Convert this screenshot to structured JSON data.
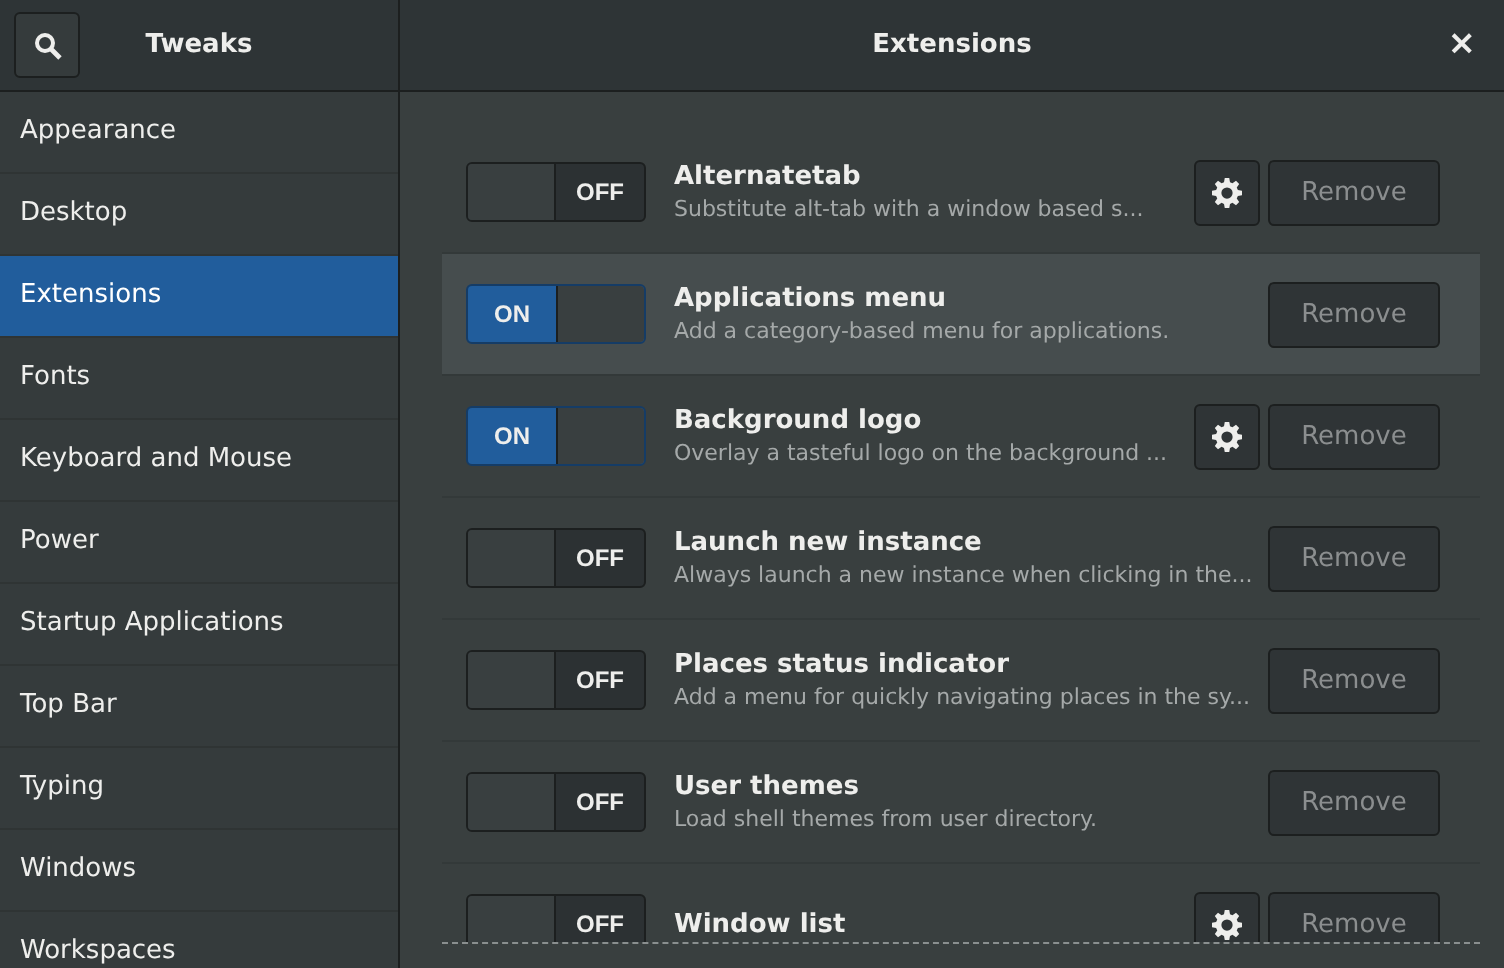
{
  "header": {
    "app_title": "Tweaks",
    "page_title": "Extensions",
    "close_label": "×"
  },
  "sidebar": {
    "items": [
      {
        "label": "Appearance",
        "selected": false
      },
      {
        "label": "Desktop",
        "selected": false
      },
      {
        "label": "Extensions",
        "selected": true
      },
      {
        "label": "Fonts",
        "selected": false
      },
      {
        "label": "Keyboard and Mouse",
        "selected": false
      },
      {
        "label": "Power",
        "selected": false
      },
      {
        "label": "Startup Applications",
        "selected": false
      },
      {
        "label": "Top Bar",
        "selected": false
      },
      {
        "label": "Typing",
        "selected": false
      },
      {
        "label": "Windows",
        "selected": false
      },
      {
        "label": "Workspaces",
        "selected": false
      }
    ]
  },
  "extensions": [
    {
      "name": "Alternatetab",
      "description": "Substitute alt-tab with a window based s...",
      "on": false,
      "toggle_label": "OFF",
      "has_settings": true,
      "selected": false,
      "remove_label": "Remove"
    },
    {
      "name": "Applications menu",
      "description": "Add a category-based menu for applications.",
      "on": true,
      "toggle_label": "ON",
      "has_settings": false,
      "selected": true,
      "remove_label": "Remove"
    },
    {
      "name": "Background logo",
      "description": "Overlay a tasteful logo on the background ...",
      "on": true,
      "toggle_label": "ON",
      "has_settings": true,
      "selected": false,
      "remove_label": "Remove"
    },
    {
      "name": "Launch new instance",
      "description": "Always launch a new instance when clicking in the...",
      "on": false,
      "toggle_label": "OFF",
      "has_settings": false,
      "selected": false,
      "remove_label": "Remove"
    },
    {
      "name": "Places status indicator",
      "description": "Add a menu for quickly navigating places in the sy...",
      "on": false,
      "toggle_label": "OFF",
      "has_settings": false,
      "selected": false,
      "remove_label": "Remove"
    },
    {
      "name": "User themes",
      "description": "Load shell themes from user directory.",
      "on": false,
      "toggle_label": "OFF",
      "has_settings": false,
      "selected": false,
      "remove_label": "Remove"
    },
    {
      "name": "Window list",
      "on": false,
      "toggle_label": "OFF",
      "has_settings": true,
      "selected": false,
      "remove_label": "Remove"
    }
  ]
}
